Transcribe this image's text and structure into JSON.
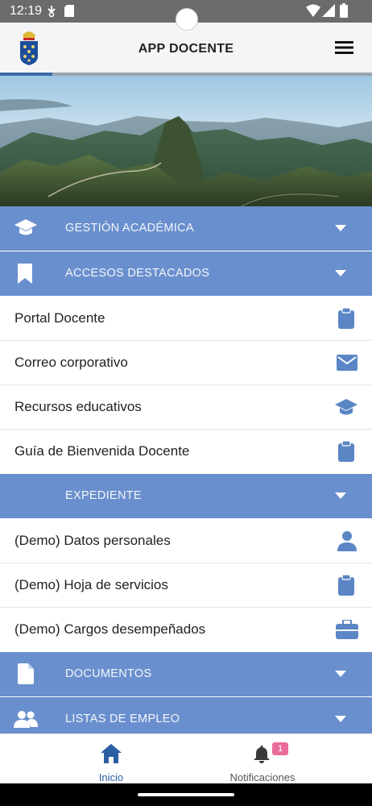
{
  "status_bar": {
    "time": "12:19",
    "icons": [
      "data-saver-icon",
      "sd-card-icon",
      "wifi-icon",
      "signal-icon",
      "battery-icon"
    ]
  },
  "app_bar": {
    "title": "APP DOCENTE",
    "logo_icon": "canarias-coat-of-arms-logo",
    "menu_icon": "hamburger-menu-icon"
  },
  "progress": {
    "fraction": 0.14
  },
  "hero": {
    "image": "mountain-landscape"
  },
  "colors": {
    "section_bg": "#6a8fce",
    "icon_blue": "#5b86c5",
    "nav_active": "#2a5fa3",
    "badge": "#e86c9a"
  },
  "sections": [
    {
      "label": "GESTIÓN ACADÉMICA",
      "icon": "graduation-cap-icon",
      "items": []
    },
    {
      "label": "ACCESOS DESTACADOS",
      "icon": "bookmark-icon",
      "items": [
        {
          "label": "Portal Docente",
          "icon": "clipboard-icon"
        },
        {
          "label": "Correo corporativo",
          "icon": "envelope-icon"
        },
        {
          "label": "Recursos educativos",
          "icon": "graduation-cap-icon"
        },
        {
          "label": "Guía de Bienvenida Docente",
          "icon": "clipboard-icon"
        }
      ]
    },
    {
      "label": "EXPEDIENTE",
      "icon": "",
      "items": [
        {
          "label": "(Demo) Datos personales",
          "icon": "person-icon"
        },
        {
          "label": "(Demo) Hoja de servicios",
          "icon": "clipboard-icon"
        },
        {
          "label": "(Demo) Cargos desempeñados",
          "icon": "briefcase-icon"
        }
      ]
    },
    {
      "label": "DOCUMENTOS",
      "icon": "document-icon",
      "items": []
    },
    {
      "label": "LISTAS DE EMPLEO",
      "icon": "users-icon",
      "items": []
    }
  ],
  "bottom_nav": {
    "home": {
      "label": "Inicio",
      "icon": "home-icon"
    },
    "notifications": {
      "label": "Notificaciones",
      "icon": "bell-icon",
      "badge": "1"
    }
  }
}
